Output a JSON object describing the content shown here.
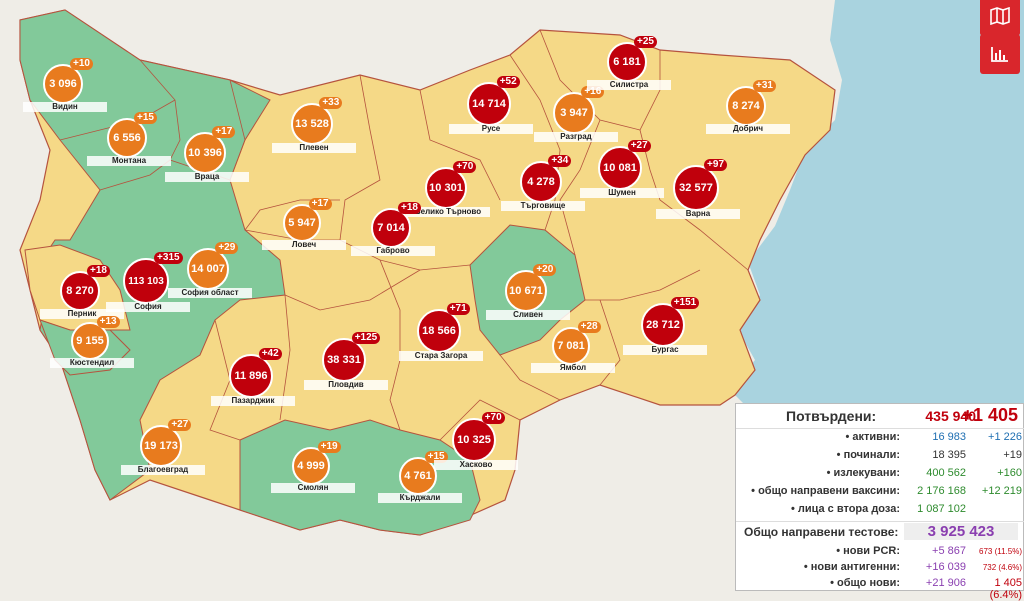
{
  "colors": {
    "sea": "#a9d3df",
    "green": "#82c99a",
    "yellow": "#f5d987",
    "red": "#c0000c",
    "orange": "#e87b1e",
    "border": "#b5533e",
    "button": "#d9262c"
  },
  "buttons": [
    {
      "icon": "map-icon"
    },
    {
      "icon": "chart-icon"
    }
  ],
  "regions": [
    {
      "name": "Видин",
      "value": "3 096",
      "delta": "+10",
      "color": "orange"
    },
    {
      "name": "Монтана",
      "value": "6 556",
      "delta": "+15",
      "color": "orange"
    },
    {
      "name": "Враца",
      "value": "10 396",
      "delta": "+17",
      "color": "orange"
    },
    {
      "name": "Плевен",
      "value": "13 528",
      "delta": "+33",
      "color": "orange"
    },
    {
      "name": "Русе",
      "value": "14 714",
      "delta": "+52",
      "color": "red"
    },
    {
      "name": "Разград",
      "value": "3 947",
      "delta": "+16",
      "color": "orange"
    },
    {
      "name": "Силистра",
      "value": "6 181",
      "delta": "+25",
      "color": "red"
    },
    {
      "name": "Добрич",
      "value": "8 274",
      "delta": "+31",
      "color": "orange"
    },
    {
      "name": "Ловеч",
      "value": "5 947",
      "delta": "+17",
      "color": "orange"
    },
    {
      "name": "Велико Търново",
      "value": "10 301",
      "delta": "+70",
      "color": "red"
    },
    {
      "name": "Търговище",
      "value": "4 278",
      "delta": "+34",
      "color": "red"
    },
    {
      "name": "Шумен",
      "value": "10 081",
      "delta": "+27",
      "color": "red"
    },
    {
      "name": "Варна",
      "value": "32 577",
      "delta": "+97",
      "color": "red"
    },
    {
      "name": "Габрово",
      "value": "7 014",
      "delta": "+18",
      "color": "red"
    },
    {
      "name": "Перник",
      "value": "8 270",
      "delta": "+18",
      "color": "red"
    },
    {
      "name": "София",
      "value": "113 103",
      "delta": "+315",
      "color": "red"
    },
    {
      "name": "София област",
      "value": "14 007",
      "delta": "+29",
      "color": "orange"
    },
    {
      "name": "Кюстендил",
      "value": "9 155",
      "delta": "+13",
      "color": "orange"
    },
    {
      "name": "Сливен",
      "value": "10 671",
      "delta": "+20",
      "color": "orange"
    },
    {
      "name": "Стара Загора",
      "value": "18 566",
      "delta": "+71",
      "color": "red"
    },
    {
      "name": "Ямбол",
      "value": "7 081",
      "delta": "+28",
      "color": "orange"
    },
    {
      "name": "Бургас",
      "value": "28 712",
      "delta": "+151",
      "color": "red"
    },
    {
      "name": "Пазарджик",
      "value": "11 896",
      "delta": "+42",
      "color": "red"
    },
    {
      "name": "Пловдив",
      "value": "38 331",
      "delta": "+125",
      "color": "red"
    },
    {
      "name": "Благоевград",
      "value": "19 173",
      "delta": "+27",
      "color": "orange"
    },
    {
      "name": "Смолян",
      "value": "4 999",
      "delta": "+19",
      "color": "orange"
    },
    {
      "name": "Кърджали",
      "value": "4 761",
      "delta": "+15",
      "color": "orange"
    },
    {
      "name": "Хасково",
      "value": "10 325",
      "delta": "+70",
      "color": "red"
    }
  ],
  "stats": {
    "confirmed_label": "Потвърдени:",
    "confirmed": "435 940",
    "confirmed_new": "+1 405",
    "rows": [
      {
        "label": "• активни:",
        "v1": "16 983",
        "v2": "+1 226",
        "c1": "#1f6fb2",
        "c2": "#1f6fb2"
      },
      {
        "label": "• починали:",
        "v1": "18 395",
        "v2": "+19",
        "c1": "#333",
        "c2": "#333"
      },
      {
        "label": "• излекувани:",
        "v1": "400 562",
        "v2": "+160",
        "c1": "#2e8b2e",
        "c2": "#2e8b2e"
      },
      {
        "label": "• общо направени ваксини:",
        "v1": "2 176 168",
        "v2": "+12 219",
        "c1": "#2e8b2e",
        "c2": "#2e8b2e"
      },
      {
        "label": "• лица с втора доза:",
        "v1": "1 087 102",
        "v2": "",
        "c1": "#2e8b2e",
        "c2": "#2e8b2e"
      }
    ],
    "tests_label": "Общо направени тестове:",
    "tests": "3 925 423",
    "test_rows": [
      {
        "label": "• нови PCR:",
        "v1": "+5 867",
        "v2": "673 (11.5%)"
      },
      {
        "label": "• нови антигенни:",
        "v1": "+16 039",
        "v2": "732 (4.6%)"
      },
      {
        "label": "• общо нови:",
        "v1": "+21 906",
        "v2": "1 405 (6.4%)"
      }
    ]
  }
}
